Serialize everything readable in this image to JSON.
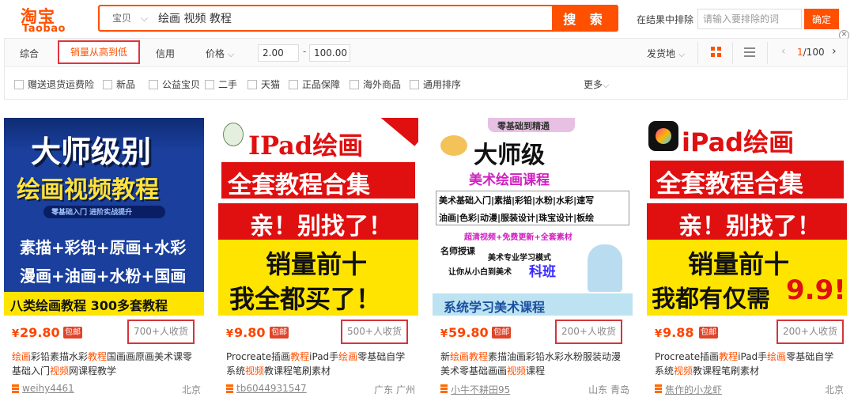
{
  "header": {
    "logo_cn": "淘宝",
    "logo_en": "Taobao",
    "search_type": "宝贝",
    "search_query": "绘画 视频 教程",
    "search_button": "搜 索",
    "exclude_label": "在结果中排除",
    "exclude_placeholder": "请输入要排除的词",
    "exclude_button": "确定"
  },
  "sortbar": {
    "default": "综合",
    "sales": "销量从高到低",
    "credit": "信用",
    "price": "价格",
    "price_min": "2.00",
    "price_max": "100.00",
    "ship_from": "发货地",
    "page": "1",
    "pages": "/100"
  },
  "filters": [
    "赠送退货运费险",
    "新品",
    "公益宝贝",
    "二手",
    "天猫",
    "正品保障",
    "海外商品",
    "通用排序"
  ],
  "more": "更多",
  "products": [
    {
      "price": "29.80",
      "yen": "¥",
      "baoyou": "包邮",
      "sales": "700+人收货",
      "title": [
        [
          "绘画",
          true
        ],
        [
          "彩铅素描水彩",
          false
        ],
        [
          "教程",
          true
        ],
        [
          "国画画原画美术课零基础入门",
          false
        ],
        [
          "视频",
          true
        ],
        [
          "网课程教学",
          false
        ]
      ],
      "shop": "weihy4461",
      "location": "北京",
      "art": {
        "line1": "大师级别",
        "line2": "绘画视频教程",
        "line3": "零基础入门 进阶实战提升",
        "line4": "素描+彩铅+原画+水彩",
        "line5": "漫画+油画+水粉+国画",
        "line6": "八类绘画教程 300多套教程"
      }
    },
    {
      "price": "9.80",
      "yen": "¥",
      "baoyou": "包邮",
      "sales": "500+人收货",
      "title": [
        [
          "Procreate插画",
          false
        ],
        [
          "教程",
          true
        ],
        [
          "iPad手",
          false
        ],
        [
          "绘画",
          true
        ],
        [
          "零基础自学系统",
          false
        ],
        [
          "视频",
          true
        ],
        [
          "教课程笔刷素材",
          false
        ]
      ],
      "shop": "tb6044931547",
      "location": "广东 广州",
      "art": {
        "line1": "IPad绘画",
        "line2": "全套教程合集",
        "line3": "亲！别找了！",
        "line4": "销量前十",
        "line5": "我全都买了！"
      }
    },
    {
      "price": "59.80",
      "yen": "¥",
      "baoyou": "包邮",
      "sales": "200+人收货",
      "title": [
        [
          "新",
          false
        ],
        [
          "绘画教程",
          true
        ],
        [
          "素描油画彩铅水彩水粉服装动漫美术零基础画画",
          false
        ],
        [
          "视频",
          true
        ],
        [
          "课程",
          false
        ]
      ],
      "shop": "小牛不耕田95",
      "location": "山东 青岛",
      "art": {
        "line1": "零基础到精通",
        "line2": "大师级",
        "line3": "美术绘画课程",
        "row1": "美术基础入门|素描|彩铅|水粉|水彩|速写",
        "row2": "油画|色彩|动漫|服装设计|珠宝设计|板绘",
        "line4": "超清视频+免费更新+全套素材",
        "line5": "名师授课",
        "line6": "美术专业学习模式",
        "line7": "让你从小白到美术",
        "line8": "科班",
        "line9": "系统学习美术课程"
      }
    },
    {
      "price": "9.88",
      "yen": "¥",
      "baoyou": "包邮",
      "sales": "200+人收货",
      "title": [
        [
          "Procreate插画",
          false
        ],
        [
          "教程",
          true
        ],
        [
          "iPad手",
          false
        ],
        [
          "绘画",
          true
        ],
        [
          "零基础自学系统",
          false
        ],
        [
          "视频",
          true
        ],
        [
          "教课程笔刷素材",
          false
        ]
      ],
      "shop": "焦作的小龙虾",
      "location": "北京",
      "art": {
        "line1": "iPad绘画",
        "line2": "全套教程合集",
        "line3": "亲！别找了！",
        "line4": "销量前十",
        "line5": "我都有仅需",
        "line6": "9.9!"
      }
    }
  ]
}
